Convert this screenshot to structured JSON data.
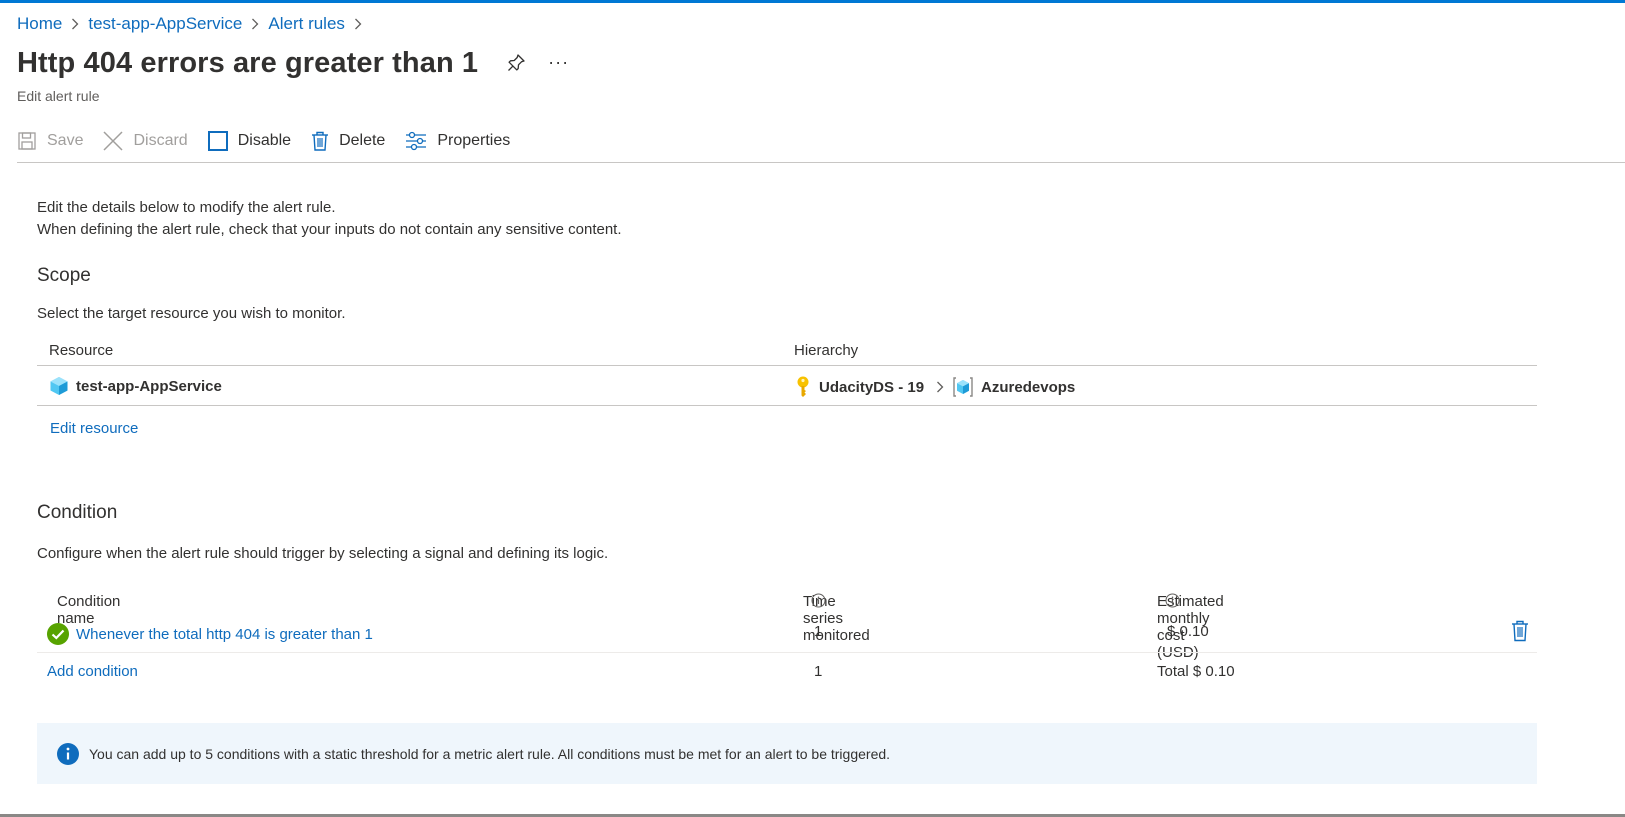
{
  "breadcrumb": {
    "items": [
      "Home",
      "test-app-AppService",
      "Alert rules"
    ]
  },
  "header": {
    "title": "Http 404 errors are greater than 1",
    "subtitle": "Edit alert rule",
    "more_label": "···"
  },
  "toolbar": {
    "save_label": "Save",
    "discard_label": "Discard",
    "disable_label": "Disable",
    "delete_label": "Delete",
    "properties_label": "Properties"
  },
  "intro": {
    "line1": "Edit the details below to modify the alert rule.",
    "line2": "When defining the alert rule, check that your inputs do not contain any sensitive content."
  },
  "scope": {
    "title": "Scope",
    "description": "Select the target resource you wish to monitor.",
    "columns": [
      "Resource",
      "Hierarchy"
    ],
    "resource_name": "test-app-AppService",
    "hierarchy": [
      "UdacityDS - 19",
      "Azuredevops"
    ],
    "edit_label": "Edit resource"
  },
  "condition": {
    "title": "Condition",
    "description": "Configure when the alert rule should trigger by selecting a signal and defining its logic.",
    "columns": [
      "Condition name",
      "Time series monitored",
      "Estimated monthly cost (USD)"
    ],
    "rows": [
      {
        "name": "Whenever the total http 404 is greater than 1",
        "time_series": "1",
        "cost": "$ 0.10"
      }
    ],
    "add_label": "Add condition",
    "total_time_series": "1",
    "total_cost": "Total $ 0.10",
    "info_text": "You can add up to 5 conditions with a static threshold for a metric alert rule. All conditions must be met for an alert to be triggered."
  },
  "colors": {
    "accent": "#0078d4",
    "link": "#0f6cbd",
    "success": "#57a300",
    "info_bg": "#eff6fc"
  }
}
